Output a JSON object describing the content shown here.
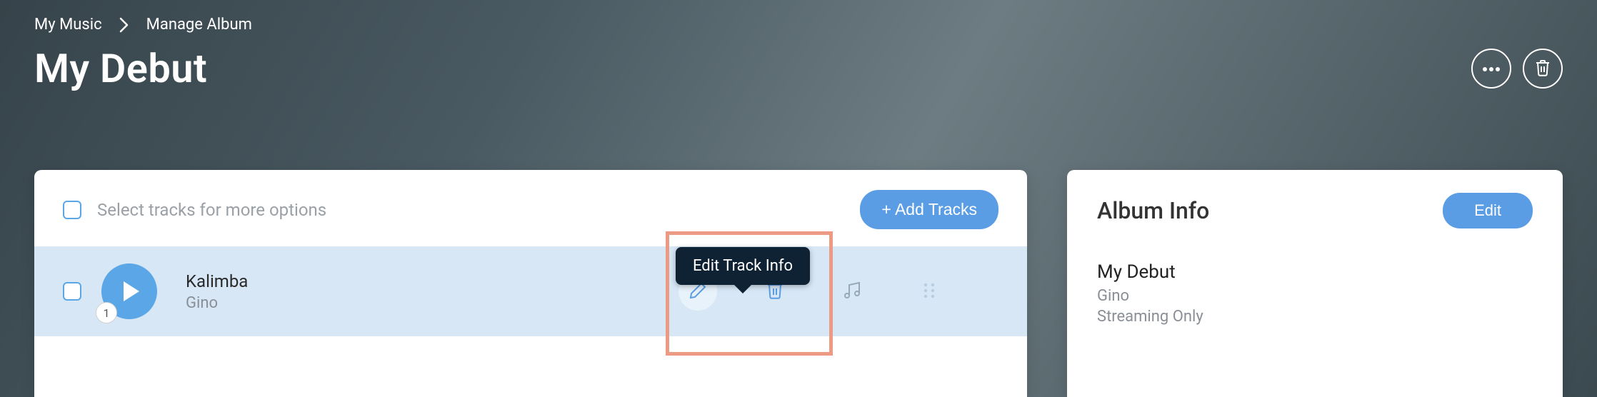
{
  "breadcrumb": {
    "items": [
      "My Music",
      "Manage Album"
    ]
  },
  "page_title": "My Debut",
  "tracks_panel": {
    "select_label": "Select tracks for more options",
    "add_button": "+ Add Tracks",
    "tooltip": "Edit Track Info",
    "track": {
      "index": "1",
      "title": "Kalimba",
      "artist": "Gino"
    }
  },
  "album_panel": {
    "section": "Album Info",
    "edit": "Edit",
    "name": "My Debut",
    "artist": "Gino",
    "mode": "Streaming Only"
  }
}
